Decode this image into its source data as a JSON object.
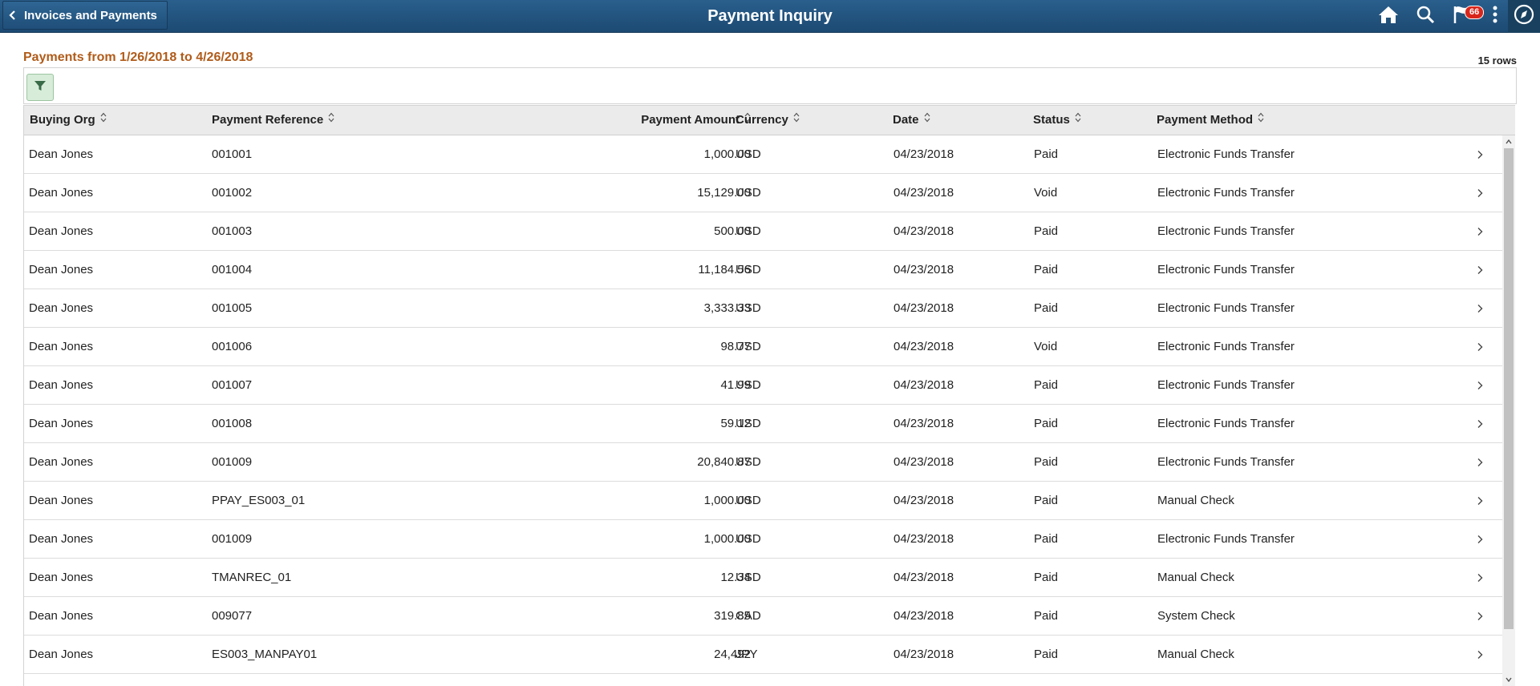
{
  "header": {
    "back_label": "Invoices and Payments",
    "title": "Payment Inquiry",
    "notification_count": "66",
    "icons": [
      "home-icon",
      "search-icon",
      "flag-icon",
      "actions-menu-icon",
      "navbar-compass-icon"
    ]
  },
  "summary": {
    "subtitle": "Payments from 1/26/2018 to 4/26/2018",
    "row_count": "15 rows"
  },
  "colors": {
    "header_bg": "#1c4a73",
    "subtitle": "#b05b19",
    "badge": "#d9261c",
    "filter_button": "#d7ecd9"
  },
  "grid": {
    "columns": [
      "Buying Org",
      "Payment Reference",
      "Payment Amount",
      "Currency",
      "Date",
      "Status",
      "Payment Method"
    ],
    "rows": [
      [
        "Dean Jones",
        "001001",
        "1,000.00",
        "USD",
        "04/23/2018",
        "Paid",
        "Electronic Funds Transfer"
      ],
      [
        "Dean Jones",
        "001002",
        "15,129.00",
        "USD",
        "04/23/2018",
        "Void",
        "Electronic Funds Transfer"
      ],
      [
        "Dean Jones",
        "001003",
        "500.00",
        "USD",
        "04/23/2018",
        "Paid",
        "Electronic Funds Transfer"
      ],
      [
        "Dean Jones",
        "001004",
        "11,184.56",
        "USD",
        "04/23/2018",
        "Paid",
        "Electronic Funds Transfer"
      ],
      [
        "Dean Jones",
        "001005",
        "3,333.33",
        "USD",
        "04/23/2018",
        "Paid",
        "Electronic Funds Transfer"
      ],
      [
        "Dean Jones",
        "001006",
        "98.77",
        "USD",
        "04/23/2018",
        "Void",
        "Electronic Funds Transfer"
      ],
      [
        "Dean Jones",
        "001007",
        "41.99",
        "USD",
        "04/23/2018",
        "Paid",
        "Electronic Funds Transfer"
      ],
      [
        "Dean Jones",
        "001008",
        "59.12",
        "USD",
        "04/23/2018",
        "Paid",
        "Electronic Funds Transfer"
      ],
      [
        "Dean Jones",
        "001009",
        "20,840.87",
        "USD",
        "04/23/2018",
        "Paid",
        "Electronic Funds Transfer"
      ],
      [
        "Dean Jones",
        "PPAY_ES003_01",
        "1,000.00",
        "USD",
        "04/23/2018",
        "Paid",
        "Manual Check"
      ],
      [
        "Dean Jones",
        "001009",
        "1,000.00",
        "USD",
        "04/23/2018",
        "Paid",
        "Electronic Funds Transfer"
      ],
      [
        "Dean Jones",
        "TMANREC_01",
        "12.34",
        "USD",
        "04/23/2018",
        "Paid",
        "Manual Check"
      ],
      [
        "Dean Jones",
        "009077",
        "319.85",
        "CAD",
        "04/23/2018",
        "Paid",
        "System Check"
      ],
      [
        "Dean Jones",
        "ES003_MANPAY01",
        "24,492",
        "JPY",
        "04/23/2018",
        "Paid",
        "Manual Check"
      ]
    ]
  }
}
